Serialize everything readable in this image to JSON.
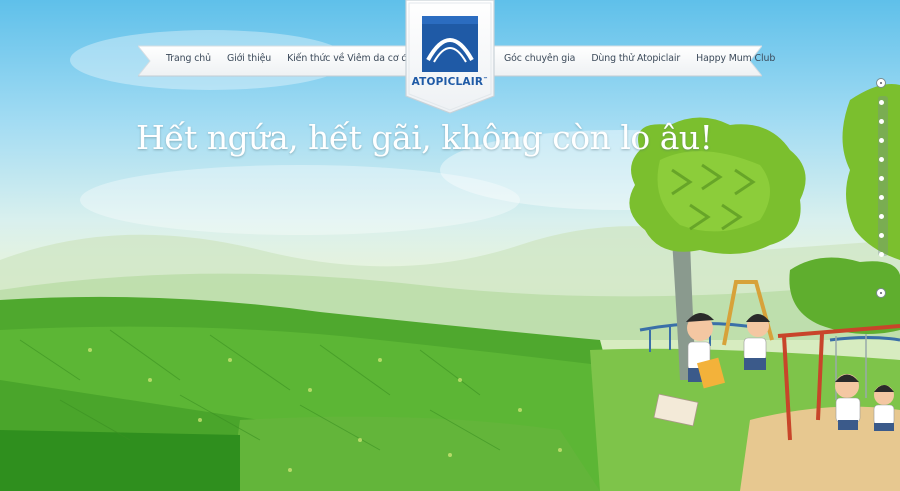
{
  "nav": {
    "left": [
      {
        "label": "Trang chủ"
      },
      {
        "label": "Giới thiệu"
      },
      {
        "label": "Kiến thức về Viêm da cơ địa"
      }
    ],
    "right": [
      {
        "label": "Góc chuyên gia"
      },
      {
        "label": "Dùng thử Atopiclair"
      },
      {
        "label": "Happy Mum Club"
      }
    ]
  },
  "logo": {
    "brand": "ATOPICLAIR",
    "trademark": "™",
    "icon": "arch-logo-icon"
  },
  "hero": {
    "headline": "Hết ngứa, hết gãi, không còn lo âu!"
  },
  "pager": {
    "slide_count": 9,
    "current": 1
  },
  "colors": {
    "brand_blue": "#1f5aa6",
    "grass": "#4fa82e",
    "sky": "#7fcdee"
  }
}
